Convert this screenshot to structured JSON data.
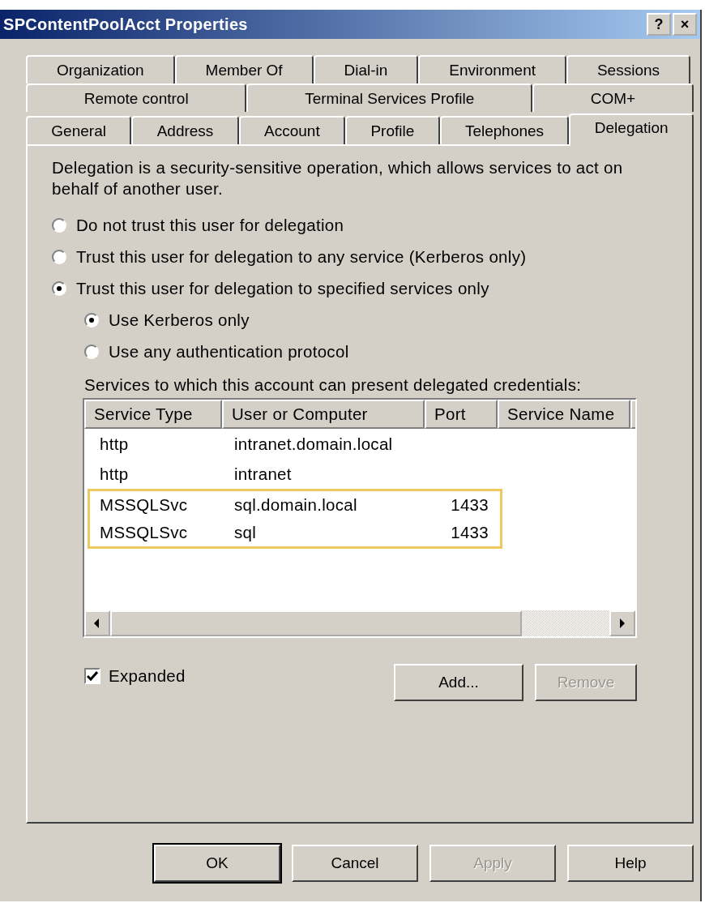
{
  "window": {
    "title": "SPContentPoolAcct Properties",
    "title_buttons": [
      "?",
      "×"
    ]
  },
  "tab_rows": [
    [
      {
        "label": "Organization",
        "selected": false
      },
      {
        "label": "Member Of",
        "selected": false
      },
      {
        "label": "Dial-in",
        "selected": false
      },
      {
        "label": "Environment",
        "selected": false
      },
      {
        "label": "Sessions",
        "selected": false
      }
    ],
    [
      {
        "label": "Remote control",
        "selected": false
      },
      {
        "label": "Terminal Services Profile",
        "selected": false
      },
      {
        "label": "COM+",
        "selected": false
      }
    ],
    [
      {
        "label": "General",
        "selected": false
      },
      {
        "label": "Address",
        "selected": false
      },
      {
        "label": "Account",
        "selected": false
      },
      {
        "label": "Profile",
        "selected": false
      },
      {
        "label": "Telephones",
        "selected": false
      },
      {
        "label": "Delegation",
        "selected": true
      }
    ]
  ],
  "description": "Delegation is a security-sensitive operation, which allows services to act on behalf of another user.",
  "trust_options": [
    {
      "label": "Do not trust this user for delegation",
      "selected": false
    },
    {
      "label": "Trust this user for delegation to any service (Kerberos only)",
      "selected": false
    },
    {
      "label": "Trust this user for delegation to specified services only",
      "selected": true
    }
  ],
  "protocol_options": [
    {
      "label": "Use Kerberos only",
      "selected": true
    },
    {
      "label": "Use any authentication protocol",
      "selected": false
    }
  ],
  "services_label": "Services to which this account can present delegated credentials:",
  "table": {
    "columns": [
      "Service Type",
      "User or Computer",
      "Port",
      "Service Name"
    ],
    "rows": [
      {
        "cells": [
          "http",
          "intranet.domain.local",
          ""
        ],
        "highlighted": false
      },
      {
        "cells": [
          "http",
          "intranet",
          ""
        ],
        "highlighted": false
      },
      {
        "cells": [
          "MSSQLSvc",
          "sql.domain.local",
          "1433"
        ],
        "highlighted": true
      },
      {
        "cells": [
          "MSSQLSvc",
          "sql",
          "1433"
        ],
        "highlighted": true
      }
    ]
  },
  "expanded": {
    "label": "Expanded",
    "checked": true
  },
  "list_buttons": [
    {
      "label": "Add...",
      "disabled": false
    },
    {
      "label": "Remove",
      "disabled": true
    }
  ],
  "dialog_buttons": [
    {
      "label": "OK",
      "disabled": false,
      "default": true
    },
    {
      "label": "Cancel",
      "disabled": false,
      "default": false
    },
    {
      "label": "Apply",
      "disabled": true,
      "default": false
    },
    {
      "label": "Help",
      "disabled": false,
      "default": false
    }
  ]
}
